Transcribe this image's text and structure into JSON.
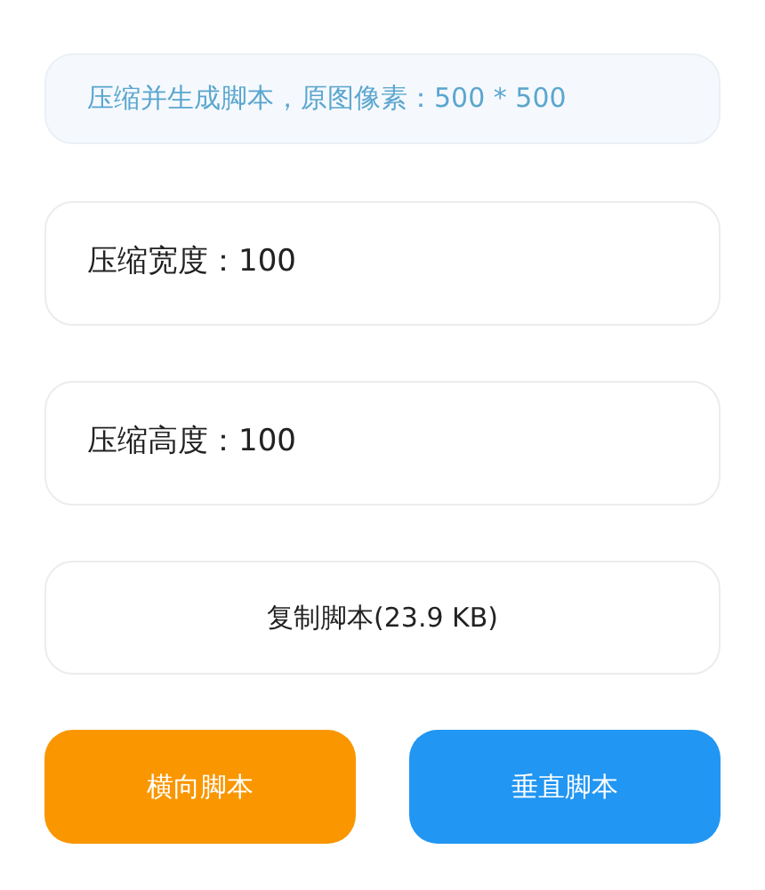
{
  "info": {
    "text": "压缩并生成脚本，原图像素：500 * 500"
  },
  "fields": [
    {
      "label": "压缩宽度：100"
    },
    {
      "label": "压缩高度：100"
    }
  ],
  "copy_button": {
    "label": "复制脚本(23.9 KB)"
  },
  "buttons": [
    {
      "label": "横向脚本",
      "color": "#fa9600"
    },
    {
      "label": "垂直脚本",
      "color": "#2196f3"
    }
  ]
}
